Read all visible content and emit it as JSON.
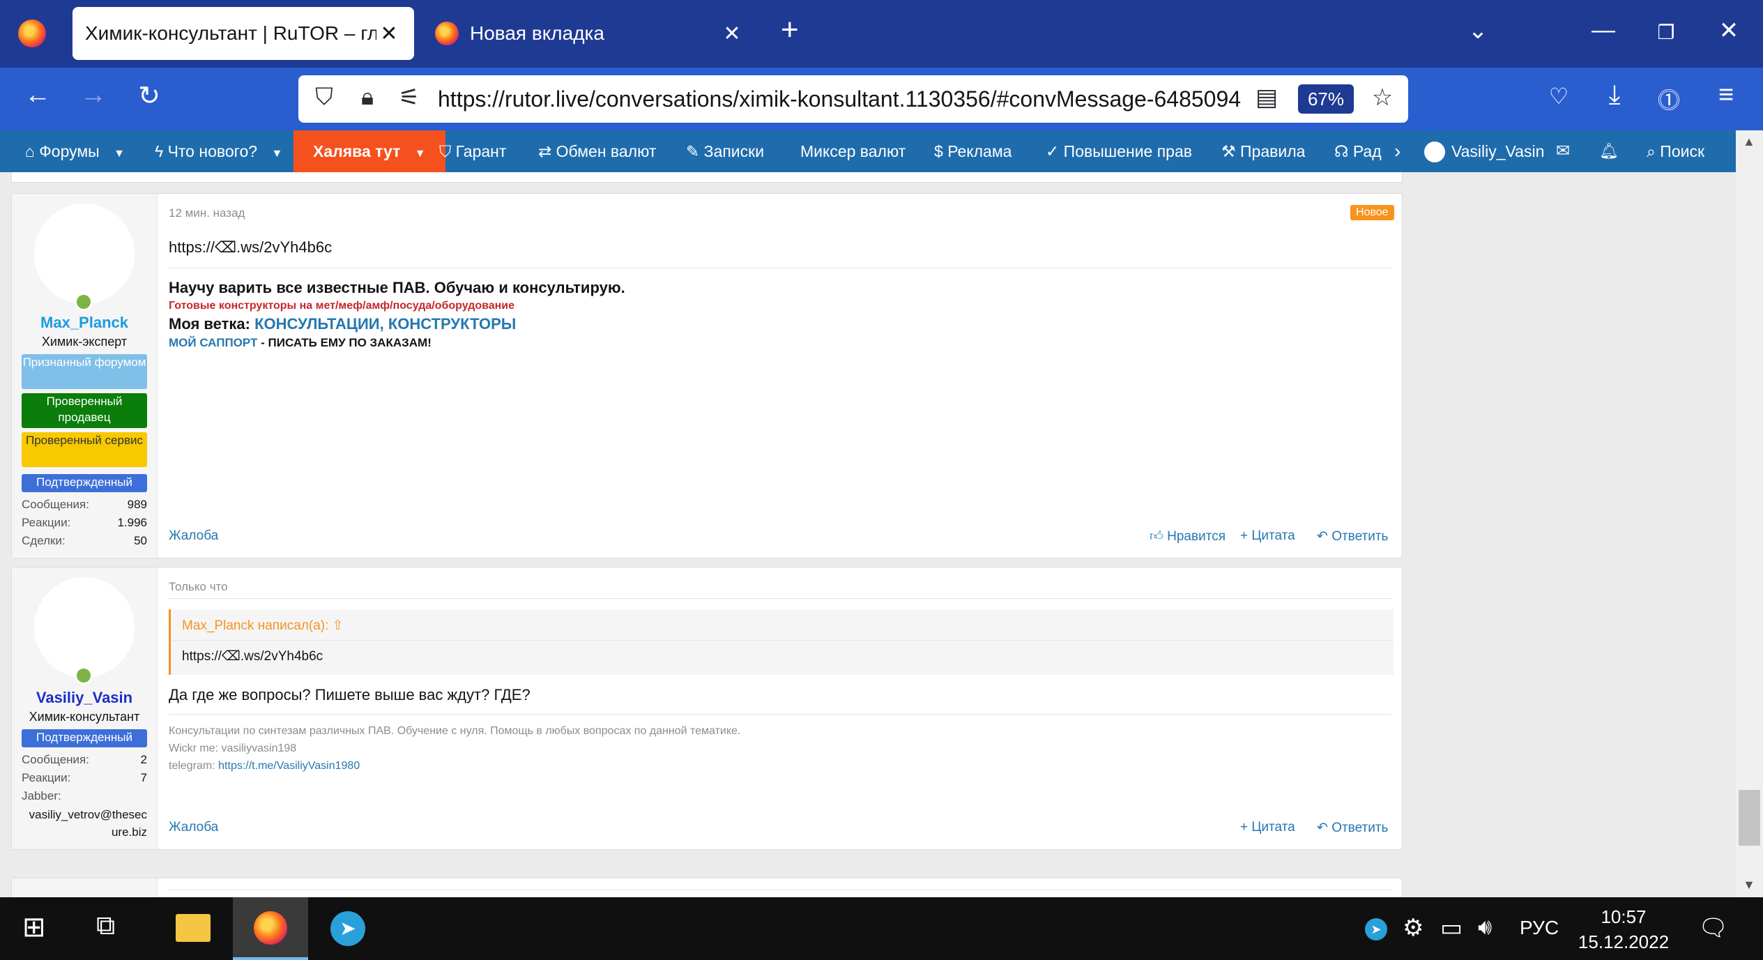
{
  "browser": {
    "tabs": [
      {
        "title": "Химик-консультант | RuTOR – главная",
        "active": true
      },
      {
        "title": "Новая вкладка",
        "active": false
      }
    ],
    "new_tab": "+",
    "url": "https://rutor.live/conversations/ximik-konsultant.1130356/#convMessage-6485094",
    "zoom": "67%"
  },
  "site_nav": {
    "items": [
      {
        "label": "Форумы",
        "icon": "home-icon",
        "dropdown": true
      },
      {
        "label": "Что нового?",
        "icon": "bolt-icon",
        "dropdown": true
      },
      {
        "label": "Халява тут",
        "icon": "",
        "dropdown": true,
        "highlight": "#f4511e"
      },
      {
        "label": "Гарант",
        "icon": "shield-check-icon"
      },
      {
        "label": "Обмен валют",
        "icon": "exchange-icon"
      },
      {
        "label": "Записки",
        "icon": "edit-icon"
      },
      {
        "label": "Миксер валют",
        "icon": ""
      },
      {
        "label": "Реклама",
        "icon": "dollar-icon"
      },
      {
        "label": "Повышение прав",
        "icon": "check-circle-icon"
      },
      {
        "label": "Правила",
        "icon": "hammer-icon"
      },
      {
        "label": "Рад",
        "icon": "headphones-icon"
      }
    ],
    "username": "Vasiliy_Vasin",
    "search": "Поиск"
  },
  "posts": [
    {
      "author": "Max_Planck",
      "author_color": "#1a9be0",
      "user_title": "Химик-эксперт",
      "badges": [
        {
          "label": "Признанный форумом",
          "color": "#7fbfe8"
        },
        {
          "label": "Проверенный продавец",
          "color": "#0b7d0b"
        },
        {
          "label": "Проверенный сервис",
          "color": "#f8c800"
        },
        {
          "label": "Подтвержденный",
          "color": "#3d6fd9"
        }
      ],
      "stats": [
        {
          "k": "Сообщения:",
          "v": "989"
        },
        {
          "k": "Реакции:",
          "v": "1.996"
        },
        {
          "k": "Сделки:",
          "v": "50"
        }
      ],
      "time": "12 мин. назад",
      "new_badge": "Новое",
      "body": "https://⌫.ws/2vYh4b6c",
      "sig_line1": "Научу варить все известные ПАВ. Обучаю и консультирую.",
      "sig_line2": "Готовые конструкторы на мет/меф/амф/посуда/оборудование",
      "sig_line3_prefix": "Моя ветка:",
      "sig_line3_link": "КОНСУЛЬТАЦИИ, КОНСТРУКТОРЫ",
      "sig_line4_link": "МОЙ САППОРТ",
      "sig_line4_rest": "- ПИСАТЬ ЕМУ ПО ЗАКАЗАМ!",
      "report": "Жалоба",
      "like": "Нравится",
      "quote": "Цитата",
      "reply": "Ответить"
    },
    {
      "author": "Vasiliy_Vasin",
      "author_color": "#1a2ec8",
      "user_title": "Химик-консультант",
      "badges": [
        {
          "label": "Подтвержденный",
          "color": "#3d6fd9"
        }
      ],
      "stats": [
        {
          "k": "Сообщения:",
          "v": "2"
        },
        {
          "k": "Реакции:",
          "v": "7"
        }
      ],
      "jabber_label": "Jabber:",
      "jabber_line1": "vasiliy_vetrov@thesec",
      "jabber_line2": "ure.biz",
      "time": "Только что",
      "quote_author": "Max_Planck написал(а):",
      "quote_text": "https://⌫.ws/2vYh4b6c",
      "body": "Да где же вопросы? Пишете выше вас ждут? ГДЕ?",
      "sig_line1": "Консультации по синтезам различных ПАВ. Обучение с нуля. Помощь в любых вопросах по данной тематике.",
      "sig_line2": "Wickr me: vasiliyvasin198",
      "sig_line3_prefix": "telegram:",
      "sig_line3_link": "https://t.me/VasiliyVasin1980",
      "report": "Жалоба",
      "quote": "Цитата",
      "reply": "Ответить"
    }
  ],
  "taskbar": {
    "lang": "РУС",
    "time": "10:57",
    "date": "15.12.2022"
  }
}
